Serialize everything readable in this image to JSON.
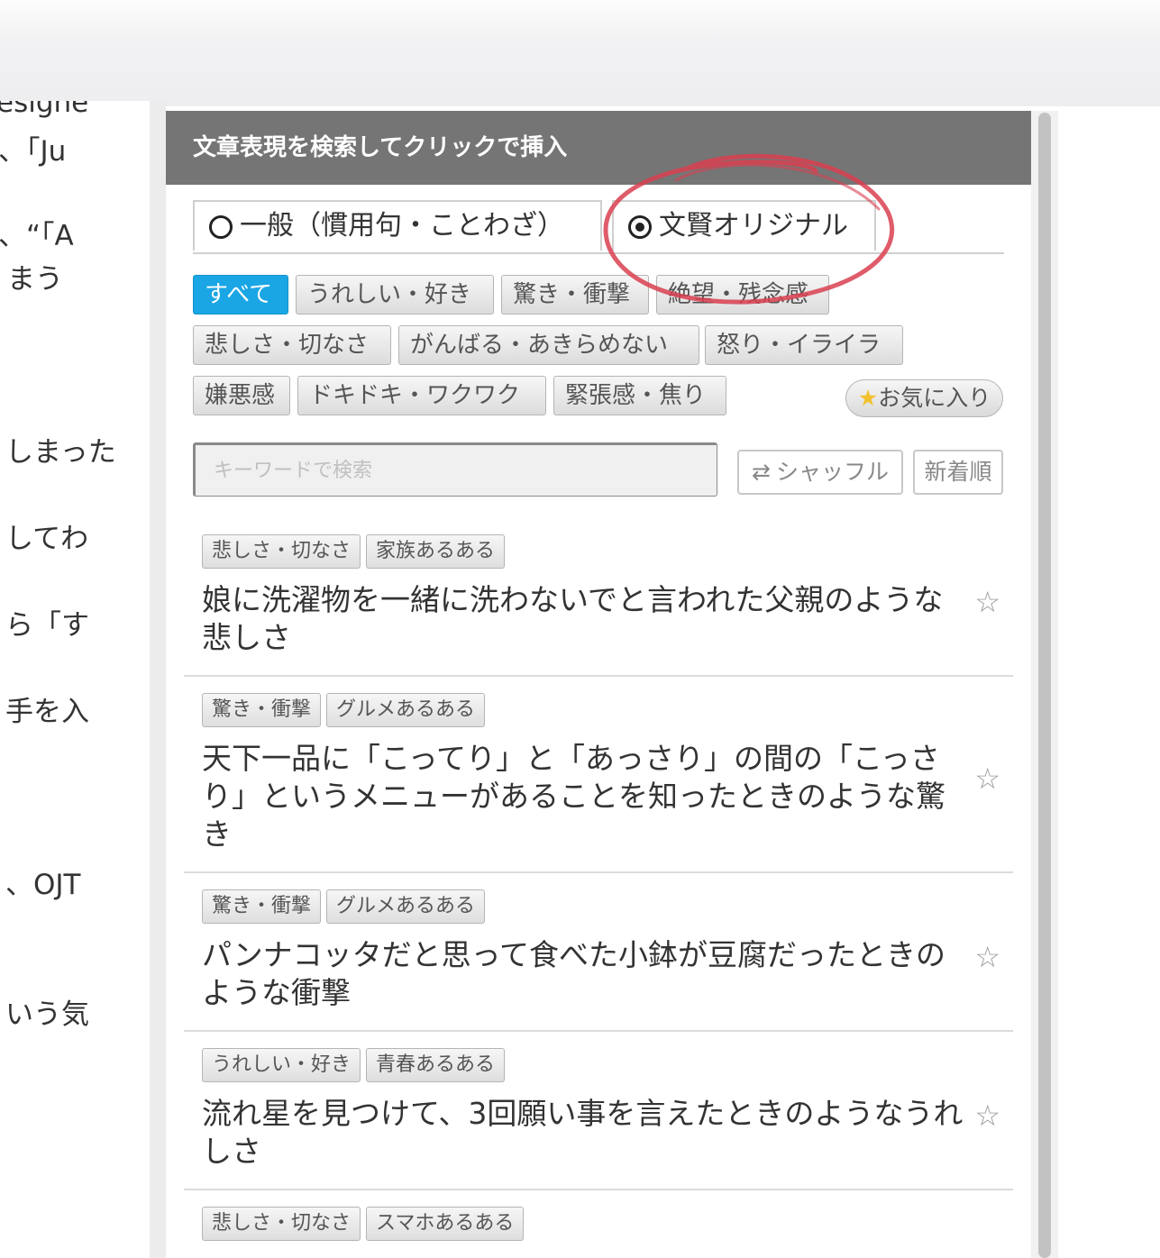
{
  "doc_fragments": [
    "esigne",
    "、「Ju",
    "、“「A",
    "まう",
    "しまった",
    "してわ",
    "ら「す",
    "手を入",
    "、OJT",
    "いう気"
  ],
  "panel": {
    "title": "文章表現を検索してクリックで挿入",
    "modes": [
      {
        "label": "一般（慣用句・ことわざ）",
        "selected": false
      },
      {
        "label": "文賢オリジナル",
        "selected": true
      }
    ],
    "categories": [
      "すべて",
      "うれしい・好き",
      "驚き・衝撃",
      "絶望・残念感",
      "悲しさ・切なさ",
      "がんばる・あきらめない",
      "怒り・イライラ",
      "嫌悪感",
      "ドキドキ・ワクワク",
      "緊張感・焦り"
    ],
    "active_category": "すべて",
    "favorites_label": "お気に入り",
    "search_placeholder": "キーワードで検索",
    "shuffle_label": "シャッフル",
    "newest_label": "新着順",
    "results": [
      {
        "tags": [
          "悲しさ・切なさ",
          "家族あるある"
        ],
        "text": "娘に洗濯物を一緒に洗わないでと言われた父親のような悲しさ"
      },
      {
        "tags": [
          "驚き・衝撃",
          "グルメあるある"
        ],
        "text": "天下一品に「こってり」と「あっさり」の間の「こっさり」というメニューがあることを知ったときのような驚き"
      },
      {
        "tags": [
          "驚き・衝撃",
          "グルメあるある"
        ],
        "text": "パンナコッタだと思って食べた小鉢が豆腐だったときのような衝撃"
      },
      {
        "tags": [
          "うれしい・好き",
          "青春あるある"
        ],
        "text": "流れ星を見つけて、3回願い事を言えたときのようなうれしさ"
      },
      {
        "tags": [
          "悲しさ・切なさ",
          "スマホあるある"
        ],
        "text": ""
      }
    ]
  },
  "icons": {
    "radio_off": "radio-empty-icon",
    "radio_on": "radio-selected-icon",
    "favorite": "star-icon",
    "shuffle": "shuffle-icon"
  },
  "colors": {
    "header_bg": "#757575",
    "active_category": "#1aa6e4",
    "annotation_circle": "#d94050"
  }
}
